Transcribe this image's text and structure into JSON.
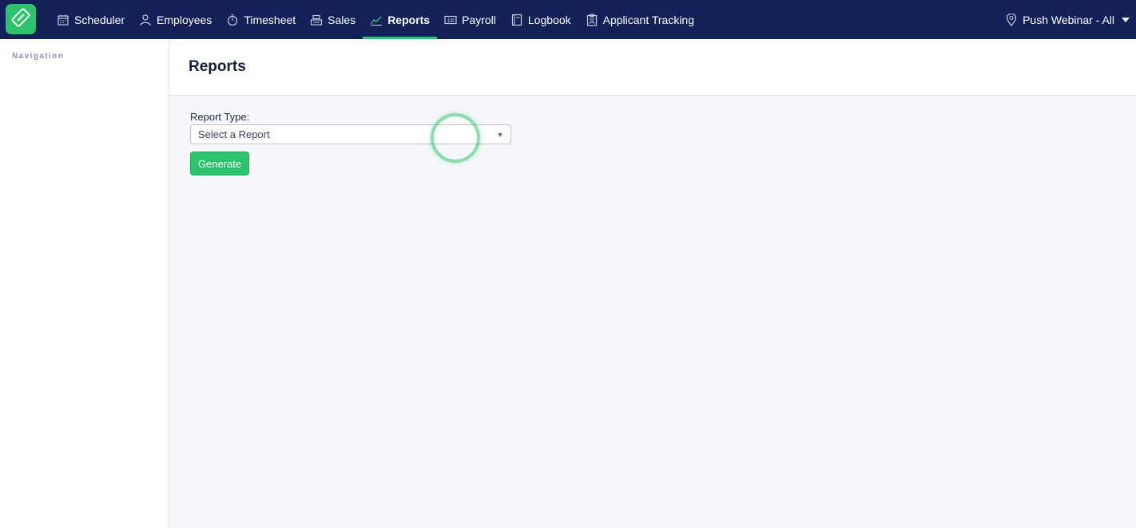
{
  "nav": {
    "items": [
      {
        "label": "Scheduler",
        "icon": "calendar-icon"
      },
      {
        "label": "Employees",
        "icon": "person-icon"
      },
      {
        "label": "Timesheet",
        "icon": "stopwatch-icon"
      },
      {
        "label": "Sales",
        "icon": "cash-register-icon"
      },
      {
        "label": "Reports",
        "icon": "chart-line-icon",
        "active": true
      },
      {
        "label": "Payroll",
        "icon": "money-icon"
      },
      {
        "label": "Logbook",
        "icon": "book-icon"
      },
      {
        "label": "Applicant Tracking",
        "icon": "clipboard-person-icon"
      }
    ],
    "location": "Push Webinar - All"
  },
  "sidebar": {
    "title": "Navigation"
  },
  "page": {
    "title": "Reports"
  },
  "form": {
    "report_type_label": "Report Type:",
    "report_select_value": "Select a Report",
    "generate_label": "Generate"
  },
  "colors": {
    "nav_bg": "#132158",
    "accent": "#2bc46c"
  }
}
